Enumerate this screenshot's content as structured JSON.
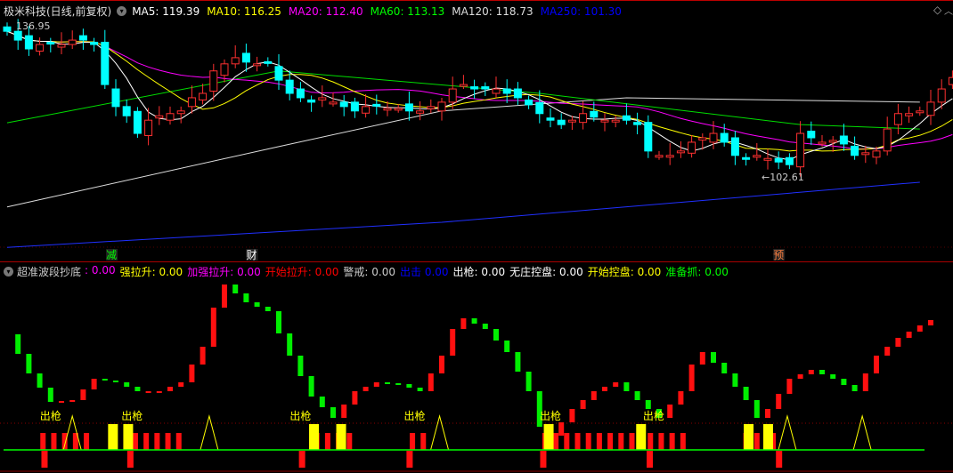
{
  "header": {
    "title": "极米科技(日线,前复权)",
    "ma": [
      {
        "label": "MA5: 119.39",
        "color": "#ffffff"
      },
      {
        "label": "MA10: 116.25",
        "color": "#ffff00"
      },
      {
        "label": "MA20: 112.40",
        "color": "#ff00ff"
      },
      {
        "label": "MA60: 113.13",
        "color": "#00ff00"
      },
      {
        "label": "MA120: 118.73",
        "color": "#dddddd"
      },
      {
        "label": "MA250: 101.30",
        "color": "#0000ff"
      }
    ]
  },
  "price_labels": {
    "high": "136.95",
    "low": "102.61"
  },
  "event_markers": [
    {
      "label": "减",
      "index": 9.6,
      "color": "#00ff00"
    },
    {
      "label": "财",
      "index": 22.5,
      "color": "#ffffff"
    },
    {
      "label": "预",
      "index": 71,
      "color": "#ff8040"
    }
  ],
  "chart_data": {
    "type": "candlestick",
    "ylim": [
      84,
      140
    ],
    "closes": [
      135.9,
      133.9,
      131.9,
      132.9,
      133.3,
      132.9,
      133.9,
      133.9,
      132.9,
      123.8,
      118.8,
      116.7,
      112.7,
      115.7,
      116.7,
      117.2,
      117.8,
      120.8,
      121.8,
      126.9,
      128.5,
      129.9,
      128.9,
      128.5,
      128.9,
      124.8,
      121.8,
      120.8,
      119.8,
      120.8,
      119.8,
      118.8,
      117.8,
      118.8,
      119.2,
      118.4,
      118.4,
      117.8,
      117.8,
      118.8,
      119.8,
      122.8,
      123.8,
      122.8,
      122.8,
      122.8,
      121.8,
      120.8,
      119.2,
      117.2,
      115.7,
      114.7,
      115.7,
      117.2,
      116.4,
      115.7,
      115.7,
      115.7,
      114.7,
      108.7,
      107.7,
      107.7,
      108.7,
      110.7,
      111.7,
      112.7,
      110.7,
      107.7,
      107.0,
      107.7,
      107.0,
      106.2,
      105.6,
      112.7,
      111.7,
      110.7,
      111.1,
      110.3,
      107.7,
      108.3,
      108.7,
      113.7,
      117.2,
      117.2,
      117.8,
      119.8,
      122.8,
      125.4
    ],
    "ma60": [
      [
        0,
        115.1
      ],
      [
        25,
        126.9
      ],
      [
        49,
        121.8
      ],
      [
        73,
        114.7
      ],
      [
        84,
        113.7
      ]
    ],
    "ma120": [
      [
        0,
        96
      ],
      [
        25,
        109.7
      ],
      [
        40,
        117.8
      ],
      [
        57,
        120.8
      ],
      [
        84,
        119.8
      ]
    ],
    "ma250": [
      [
        0,
        86.8
      ],
      [
        40,
        92.5
      ],
      [
        84,
        101.6
      ]
    ]
  },
  "indicator": {
    "title": "超准波段抄底",
    "legend": [
      {
        "label": ":",
        "value": "0.00",
        "color": "#ff00ff"
      },
      {
        "label": "强拉升:",
        "value": "0.00",
        "color": "#ffff00"
      },
      {
        "label": "加强拉升:",
        "value": "0.00",
        "color": "#ff00ff"
      },
      {
        "label": "开始拉升:",
        "value": "0.00",
        "color": "#ff0000"
      },
      {
        "label": "警戒:",
        "value": "0.00",
        "color": "#cccccc"
      },
      {
        "label": "出击",
        "value": "0.00",
        "color": "#0000ff"
      },
      {
        "label": "出枪:",
        "value": "0.00",
        "color": "#ffffff"
      },
      {
        "label": "无庄控盘:",
        "value": "0.00",
        "color": "#ffffff"
      },
      {
        "label": "开始控盘:",
        "value": "0.00",
        "color": "#ffff00"
      },
      {
        "label": "准备抓:",
        "value": "0.00",
        "color": "#00ff00"
      }
    ],
    "wave": [
      [
        0,
        62
      ],
      [
        2,
        40
      ],
      [
        4,
        24
      ],
      [
        6,
        25
      ],
      [
        8,
        37
      ],
      [
        10,
        35
      ],
      [
        12,
        30
      ],
      [
        14,
        30
      ],
      [
        16,
        35
      ],
      [
        18,
        55
      ],
      [
        19,
        77
      ],
      [
        20,
        90
      ],
      [
        22,
        80
      ],
      [
        24,
        75
      ],
      [
        26,
        50
      ],
      [
        28,
        27
      ],
      [
        30,
        15
      ],
      [
        32,
        30
      ],
      [
        34,
        35
      ],
      [
        36,
        34
      ],
      [
        38,
        30
      ],
      [
        40,
        50
      ],
      [
        41,
        65
      ],
      [
        42,
        71
      ],
      [
        44,
        65
      ],
      [
        46,
        52
      ],
      [
        48,
        30
      ],
      [
        49,
        10
      ],
      [
        50,
        5
      ],
      [
        52,
        20
      ],
      [
        54,
        30
      ],
      [
        56,
        35
      ],
      [
        58,
        25
      ],
      [
        60,
        15
      ],
      [
        62,
        30
      ],
      [
        63,
        45
      ],
      [
        64,
        52
      ],
      [
        66,
        40
      ],
      [
        68,
        25
      ],
      [
        69,
        15
      ],
      [
        70,
        20
      ],
      [
        72,
        37
      ],
      [
        74,
        42
      ],
      [
        76,
        37
      ],
      [
        78,
        30
      ],
      [
        79,
        40
      ],
      [
        80,
        50
      ],
      [
        82,
        60
      ],
      [
        84,
        67
      ],
      [
        85,
        70
      ]
    ],
    "signal_label": "出枪",
    "signal_indices": [
      4,
      11.5,
      27,
      37.5,
      50,
      59.5
    ],
    "red_bars": [
      3.3,
      4.3,
      5.3,
      6.3,
      7.3,
      11.8,
      12.8,
      13.8,
      14.8,
      15.8,
      28.5,
      29.5,
      30.5,
      31.5,
      37.3,
      38.3,
      49.5,
      50.5,
      51.5,
      52.5,
      53.5,
      54.5,
      55.5,
      56.5,
      57.5,
      59.2,
      60.2,
      61.2,
      62.2,
      68,
      69,
      70.5
    ],
    "yellow_bars": [
      9.7,
      11.1,
      28.2,
      30.7,
      49.8,
      58.3,
      68.2,
      70
    ],
    "triangles": [
      6,
      18.6,
      39.8,
      71.8,
      78.7
    ],
    "bottom_bars": [
      3.4,
      11.3,
      27.1,
      37,
      49.3,
      59.1,
      71
    ]
  }
}
